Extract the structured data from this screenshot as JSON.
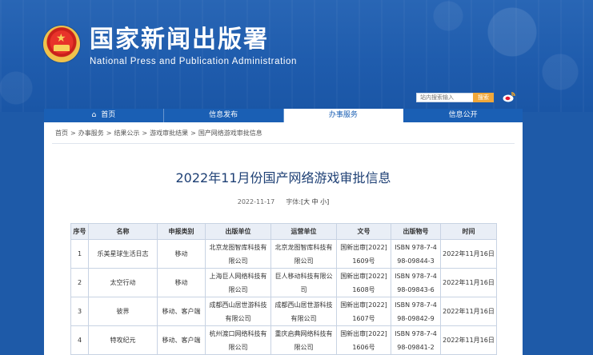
{
  "header": {
    "title_cn": "国家新闻出版署",
    "title_en": "National Press and Publication Administration",
    "search_placeholder": "站内搜索输入",
    "search_button": "搜索"
  },
  "nav": {
    "items": [
      {
        "label": "首页",
        "icon": "home-icon",
        "active": false
      },
      {
        "label": "信息发布",
        "active": false
      },
      {
        "label": "办事服务",
        "active": true
      },
      {
        "label": "信息公开",
        "active": false
      }
    ]
  },
  "breadcrumb": [
    "首页",
    "办事服务",
    "结果公示",
    "游戏审批结果",
    "国产网络游戏审批信息"
  ],
  "article": {
    "title": "2022年11月份国产网络游戏审批信息",
    "date": "2022-11-17",
    "font_label": "字体:",
    "font_sizes": "[大 中 小]"
  },
  "table": {
    "headers": [
      "序号",
      "名称",
      "申报类别",
      "出版单位",
      "运营单位",
      "文号",
      "出版物号",
      "时间"
    ],
    "rows": [
      [
        "1",
        "乐美星球生活日志",
        "移动",
        "北京龙图智库科技有限公司",
        "北京龙图智库科技有限公司",
        "国新出审[2022]1609号",
        "ISBN 978-7-498-09844-3",
        "2022年11月16日"
      ],
      [
        "2",
        "太空行动",
        "移动",
        "上海巨人网络科技有限公司",
        "巨人移动科技有限公司",
        "国新出审[2022]1608号",
        "ISBN 978-7-498-09843-6",
        "2022年11月16日"
      ],
      [
        "3",
        "彼界",
        "移动、客户端",
        "成都西山居世游科技有限公司",
        "成都西山居世游科技有限公司",
        "国新出审[2022]1607号",
        "ISBN 978-7-498-09842-9",
        "2022年11月16日"
      ],
      [
        "4",
        "特攻纪元",
        "移动、客户端",
        "杭州渡口网络科技有限公司",
        "重庆启典网络科技有限公司",
        "国新出审[2022]1606号",
        "ISBN 978-7-498-09841-2",
        "2022年11月16日"
      ]
    ]
  }
}
